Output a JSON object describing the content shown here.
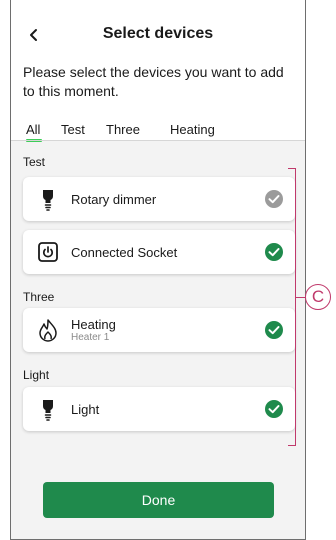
{
  "header": {
    "title": "Select devices",
    "instruction": "Please select the devices you want to add to this moment."
  },
  "tabs": [
    {
      "label": "All",
      "selected": true
    },
    {
      "label": "Test"
    },
    {
      "label": "Three"
    },
    {
      "label": "Heating"
    }
  ],
  "sections": [
    {
      "title": "Test",
      "devices": [
        {
          "name": "Rotary dimmer",
          "icon": "light-bulb-icon",
          "status": "checked-disabled"
        },
        {
          "name": "Connected Socket",
          "icon": "socket-icon",
          "status": "checked"
        }
      ]
    },
    {
      "title": "Three",
      "devices": [
        {
          "name": "Heating",
          "subtitle": "Heater 1",
          "icon": "flame-icon",
          "status": "checked"
        }
      ]
    },
    {
      "title": "Light",
      "devices": [
        {
          "name": "Light",
          "icon": "light-bulb-icon",
          "status": "checked"
        }
      ]
    }
  ],
  "done_label": "Done",
  "callout": {
    "label": "C"
  },
  "colors": {
    "accent_green": "#3dcd58",
    "check_green": "#1f8a4c",
    "check_grey": "#9b9b9b",
    "callout": "#c0396b"
  }
}
